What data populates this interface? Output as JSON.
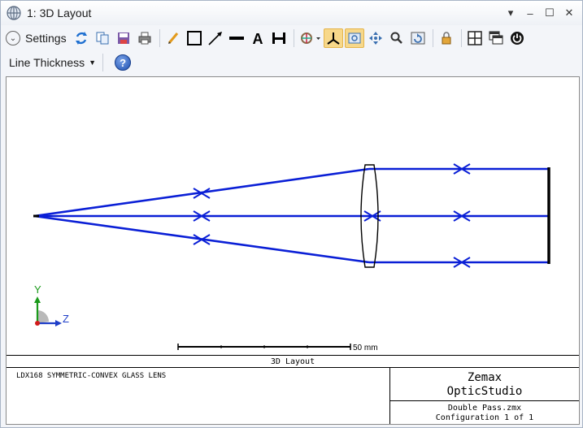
{
  "window": {
    "title": "1: 3D Layout",
    "controls": {
      "dropdown": "▾",
      "minimize": "‒",
      "maximize": "☐",
      "close": "✕"
    }
  },
  "toolbar": {
    "settings_label": "Settings",
    "icons": [
      "refresh-icon",
      "copy-icon",
      "save-icon",
      "print-icon",
      "pencil-icon",
      "rectangle-icon",
      "arrow-icon",
      "line-icon",
      "text-icon",
      "dimension-icon",
      "rotate-icon",
      "axis-icon",
      "camera-icon",
      "pan-icon",
      "zoom-icon",
      "reset-icon",
      "lock-icon",
      "window-icon",
      "window-stack-icon",
      "power-icon"
    ]
  },
  "toolbar2": {
    "line_thickness_label": "Line Thickness",
    "help_label": "?"
  },
  "plot": {
    "scale_bar_label": "50 mm",
    "axis_y": "Y",
    "axis_z": "Z",
    "caption_title": "3D Layout",
    "lens_description": "LDX168 SYMMETRIC-CONVEX GLASS LENS",
    "brand_line1": "Zemax",
    "brand_line2": "OpticStudio",
    "file_name": "Double Pass.zmx",
    "configuration": "Configuration 1 of 1",
    "ray_color": "#0a1fd6"
  }
}
